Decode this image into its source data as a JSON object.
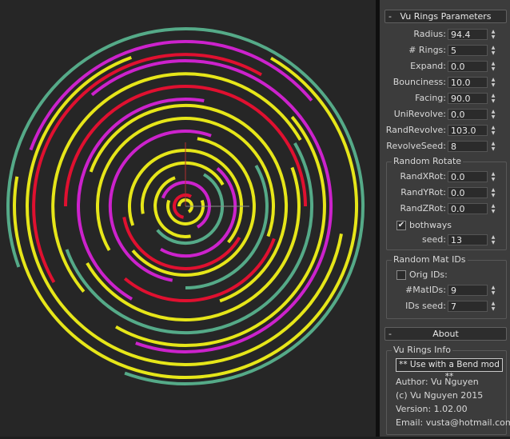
{
  "rings_params": {
    "title": "Vu Rings Parameters",
    "collapse_symbol": "-",
    "fields": [
      {
        "label": "Radius:",
        "value": "94.4"
      },
      {
        "label": "# Rings:",
        "value": "5"
      },
      {
        "label": "Expand:",
        "value": "0.0"
      },
      {
        "label": "Bounciness:",
        "value": "10.0"
      },
      {
        "label": "Facing:",
        "value": "90.0"
      },
      {
        "label": "UniRevolve:",
        "value": "0.0"
      },
      {
        "label": "RandRevolve:",
        "value": "103.0"
      },
      {
        "label": "RevolveSeed:",
        "value": "8"
      }
    ],
    "random_rotate": {
      "title": "Random Rotate",
      "fields": [
        {
          "label": "RandXRot:",
          "value": "0.0"
        },
        {
          "label": "RandYRot:",
          "value": "0.0"
        },
        {
          "label": "RandZRot:",
          "value": "0.0"
        }
      ],
      "bothways_label": "bothways",
      "bothways_checked": true,
      "seed_label": "seed:",
      "seed_value": "13"
    },
    "random_mat_ids": {
      "title": "Random Mat IDs",
      "orig_ids_label": "Orig IDs:",
      "orig_ids_checked": false,
      "fields": [
        {
          "label": "#MatIDs:",
          "value": "9"
        },
        {
          "label": "IDs seed:",
          "value": "7"
        }
      ]
    }
  },
  "about": {
    "title": "About",
    "collapse_symbol": "-",
    "group_title": "Vu Rings Info",
    "note": "** Use with a Bend mod **",
    "author": "Author: Vu Nguyen",
    "copyright": "(c) Vu Nguyen 2015",
    "version": "Version: 1.02.00",
    "email": "Email: vusta@hotmail.com"
  },
  "spinner": {
    "up": "▲",
    "down": "▼"
  },
  "checkmark": "✔",
  "colors": {
    "yellow": "#e6e619",
    "magenta": "#cc22cc",
    "red": "#e01030",
    "teal": "#55aa88",
    "background": "#262626"
  }
}
